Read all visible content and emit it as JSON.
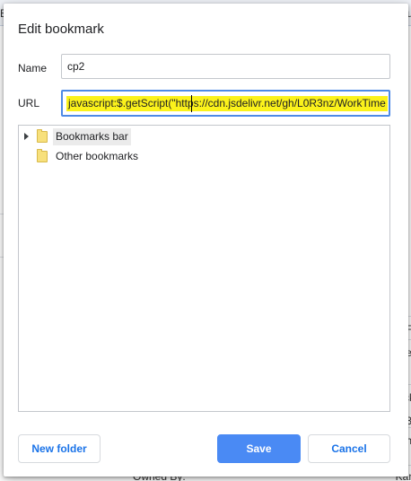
{
  "background": {
    "fragments": [
      "su",
      "E",
      "F",
      "e",
      "ck",
      "3",
      "h",
      "Owned By:",
      "Kan"
    ]
  },
  "dialog": {
    "title": "Edit bookmark",
    "name_label": "Name",
    "name_value": "cp2",
    "url_label": "URL",
    "url_value": "javascript:$.getScript(\"https://cdn.jsdelivr.net/gh/L0R3nz/WorkTime",
    "accent_color": "#4d8ae6",
    "highlight_color": "#fbf21b",
    "folders": [
      {
        "label": "Bookmarks bar",
        "icon": "folder-icon",
        "expandable": true,
        "selected": true
      },
      {
        "label": "Other bookmarks",
        "icon": "folder-icon",
        "expandable": false,
        "selected": false
      }
    ],
    "buttons": {
      "new_folder": "New folder",
      "save": "Save",
      "cancel": "Cancel"
    }
  }
}
